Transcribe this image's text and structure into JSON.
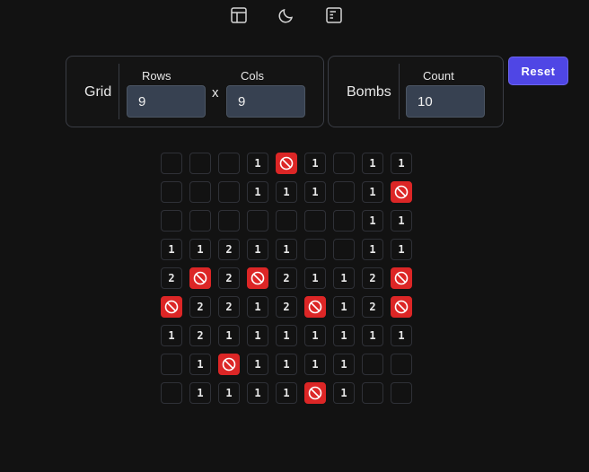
{
  "toolbar": {
    "icons": [
      "layout-icon",
      "moon-icon",
      "panel-icon"
    ]
  },
  "grid_panel": {
    "label": "Grid",
    "rows_label": "Rows",
    "rows_value": "9",
    "times": "x",
    "cols_label": "Cols",
    "cols_value": "9"
  },
  "bombs_panel": {
    "label": "Bombs",
    "count_label": "Count",
    "count_value": "10"
  },
  "reset_label": "Reset",
  "colors": {
    "accent": "#4f46e5",
    "bomb": "#dc2626",
    "background": "#121212"
  },
  "board": {
    "rows": [
      [
        "",
        "",
        "",
        "1",
        "B",
        "1",
        "",
        "1",
        "1"
      ],
      [
        "",
        "",
        "",
        "1",
        "1",
        "1",
        "",
        "1",
        "B"
      ],
      [
        "",
        "",
        "",
        "",
        "",
        "",
        "",
        "1",
        "1"
      ],
      [
        "1",
        "1",
        "2",
        "1",
        "1",
        "",
        "",
        "1",
        "1"
      ],
      [
        "2",
        "B",
        "2",
        "B",
        "2",
        "1",
        "1",
        "2",
        "B"
      ],
      [
        "B",
        "2",
        "2",
        "1",
        "2",
        "B",
        "1",
        "2",
        "B"
      ],
      [
        "1",
        "2",
        "1",
        "1",
        "1",
        "1",
        "1",
        "1",
        "1"
      ],
      [
        "",
        "1",
        "B",
        "1",
        "1",
        "1",
        "1",
        "",
        ""
      ],
      [
        "",
        "1",
        "1",
        "1",
        "1",
        "B",
        "1",
        "",
        ""
      ]
    ]
  }
}
